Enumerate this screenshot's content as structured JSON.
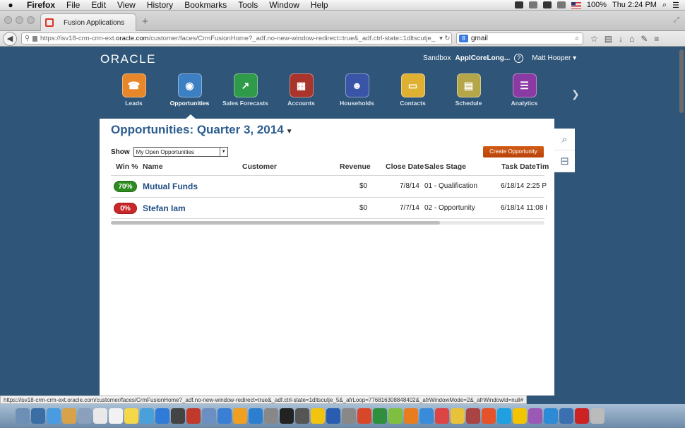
{
  "menubar": {
    "app": "Firefox",
    "items": [
      "File",
      "Edit",
      "View",
      "History",
      "Bookmarks",
      "Tools",
      "Window",
      "Help"
    ],
    "battery": "100%",
    "clock": "Thu 2:24 PM"
  },
  "browser": {
    "tab_title": "Fusion Applications",
    "url_prefix": "https://isv18-crm-crm-ext.",
    "url_host": "oracle.com",
    "url_rest": "/customer/faces/CrmFusionHome?_adf.no-new-window-redirect=true&_adf.ctrl-state=1dltscutje_",
    "search_value": "gmail",
    "status_url": "https://isv18-crm-crm-ext.oracle.com/customer/faces/CrmFusionHome?_adf.no-new-window-redirect=true&_adf.ctrl-state=1dltscutje_5&_afrLoop=776816308848402&_afrWindowMode=2&_afrWindowId=null#"
  },
  "header": {
    "logo": "ORACLE",
    "sandbox_label": "Sandbox",
    "sandbox_name": "AppICoreLong...",
    "user": "Matt Hooper"
  },
  "launcher": [
    {
      "label": "Leads",
      "color": "#e8872a",
      "glyph": "☎"
    },
    {
      "label": "Opportunities",
      "color": "#3c7fc2",
      "glyph": "◉"
    },
    {
      "label": "Sales Forecasts",
      "color": "#2f9a49",
      "glyph": "↗"
    },
    {
      "label": "Accounts",
      "color": "#a8342b",
      "glyph": "▦"
    },
    {
      "label": "Households",
      "color": "#3a55a8",
      "glyph": "☻"
    },
    {
      "label": "Contacts",
      "color": "#e0b032",
      "glyph": "▭"
    },
    {
      "label": "Schedule",
      "color": "#b6a64a",
      "glyph": "▤"
    },
    {
      "label": "Analytics",
      "color": "#8b3aa3",
      "glyph": "☰"
    }
  ],
  "panel": {
    "title": "Opportunities: Quarter 3, 2014",
    "show_label": "Show",
    "show_value": "My Open Opportunities",
    "create_button": "Create Opportunity",
    "columns": {
      "win": "Win %",
      "name": "Name",
      "customer": "Customer",
      "revenue": "Revenue",
      "close": "Close Date",
      "stage": "Sales Stage",
      "task": "Task DateTim"
    },
    "rows": [
      {
        "win": "70%",
        "name": "Mutual Funds",
        "revenue": "$0",
        "close": "7/8/14",
        "stage": "01 - Qualification",
        "task": "6/18/14 2:25 P"
      },
      {
        "win": "0%",
        "name": "Stefan Iam",
        "revenue": "$0",
        "close": "7/7/14",
        "stage": "02 - Opportunity",
        "task": "6/18/14 11:08 I"
      }
    ]
  }
}
